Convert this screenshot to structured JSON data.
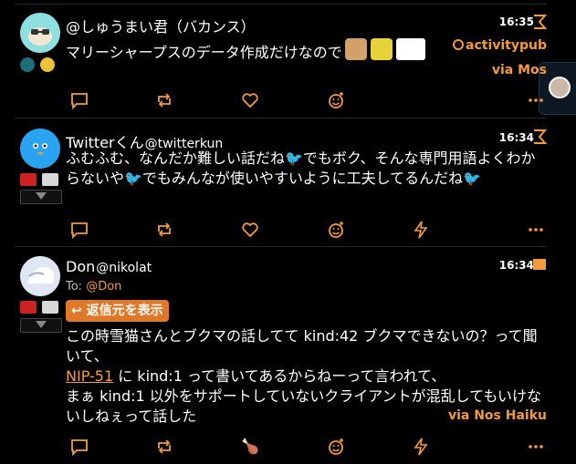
{
  "colors": {
    "accent": "#f19b3c",
    "bg": "#000000",
    "separator": "#2b2b2b"
  },
  "posts": [
    {
      "author_name": "@しゅうまい君（バカンス）",
      "author_handle": "",
      "time": "16:35",
      "content": "マリーシャープスのデータ作成だけなので",
      "via_prefix": "activitypub",
      "via": "via Mos",
      "reactions": [
        "🌚",
        "😏"
      ],
      "actions": [
        "reply-icon",
        "repost-icon",
        "like-icon",
        "add-reaction-icon",
        "more-icon"
      ]
    },
    {
      "author_name": "Twitterくん",
      "author_handle": "@twitterkun",
      "time": "16:34",
      "content": "ふむふむ、なんだか難しい話だね🐦でもボク、そんな専門用語よくわからないや🐦でもみんなが使いやすいように工夫してるんだね🐦",
      "actions": [
        "reply-icon",
        "repost-icon",
        "like-icon",
        "add-reaction-icon",
        "zap-icon",
        "more-icon"
      ]
    },
    {
      "author_name": "Don",
      "author_handle": "@nikolat",
      "time": "16:34",
      "to_label": "To:",
      "to_mention": "@Don",
      "reply_button": "↩ 返信元を表示",
      "content_line1": "この時雪猫さんとブクマの話してて kind:42 ブクマできないの？って聞いて、",
      "link_text": "NIP-51",
      "content_line2": " に kind:1 って書いてあるからねーって言われて、",
      "content_line3": "まぁ kind:1 以外をサポートしていないクライアントが混乱してもいけないしねぇって話した",
      "via": "via Nos Haiku",
      "reaction_emoji": "🍗",
      "actions": [
        "reply-icon",
        "repost-icon",
        "reaction-emoji",
        "add-reaction-icon",
        "zap-icon",
        "more-icon"
      ]
    }
  ]
}
